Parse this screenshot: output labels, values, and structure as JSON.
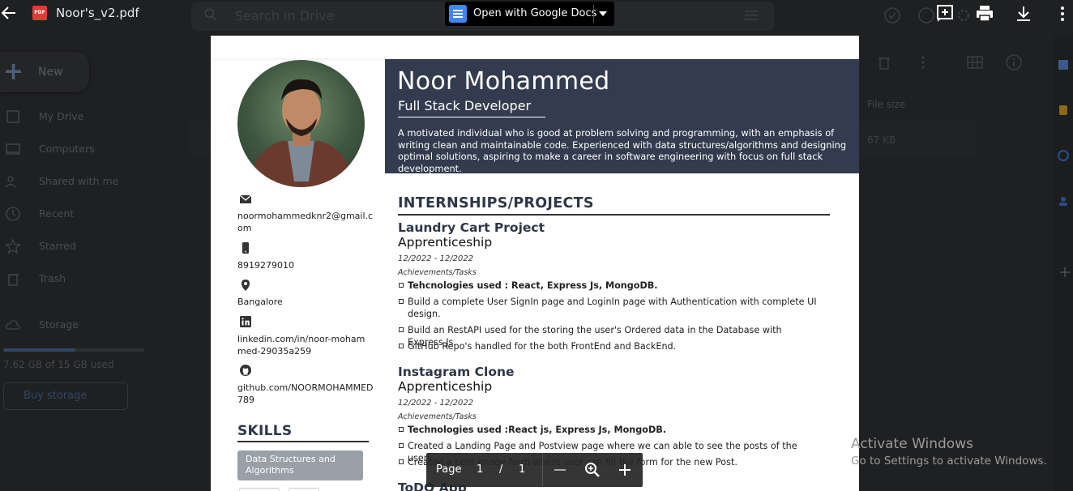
{
  "viewer": {
    "file_name": "Noor's_v2.pdf",
    "pdf_badge": "PDF",
    "open_with_label": "Open with Google Docs"
  },
  "drive": {
    "search_placeholder": "Search in Drive",
    "new_label": "New",
    "nav": [
      "My Drive",
      "Computers",
      "Shared with me",
      "Recent",
      "Starred",
      "Trash",
      "Storage"
    ],
    "storage_used": "7.62 GB of 15 GB used",
    "storage_fraction": 0.51,
    "buy_storage": "Buy storage",
    "col_file_size": "File size",
    "file_size_value": "67 KB"
  },
  "resume": {
    "name": "Noor Mohammed",
    "role": "Full Stack Developer",
    "summary": "A motivated individual who is good at problem solving and programming, with an emphasis of writing clean and maintainable code. Experienced with data structures/algorithms and designing optimal solutions, aspiring to make a career in software engineering with focus on full stack development.",
    "contact": {
      "email": "noormohammedknr2@gmail.com",
      "phone": "8919279010",
      "location": "Bangalore",
      "linkedin": "linkedin.com/in/noor-mohammed-29035a259",
      "github": "github.com/NOORMOHAMMED789"
    },
    "skills_title": "SKILLS",
    "skills": [
      "Data Structures and Algorithms"
    ],
    "section_title": "INTERNSHIPS/PROJECTS",
    "projects": [
      {
        "title": "Laundry Cart Project",
        "role": "Apprenticeship",
        "date": "12/2022 - 12/2022",
        "achievements_label": "Achievements/Tasks",
        "bullets": [
          "Tehcnologies used : React, Express Js, MongoDB.",
          "Build a complete User SignIn page and LoginIn page with Authentication with complete UI design.",
          "Build an RestAPI used for the storing the user's Ordered data in the Database with Express Js.",
          "GitHub Repo's handled for the both FrontEnd and BackEnd."
        ]
      },
      {
        "title": "Instagram Clone",
        "role": "Apprenticeship",
        "date": "12/2022 - 12/2022",
        "achievements_label": "Achievements/Tasks",
        "bullets": [
          "Technologies used :React js, Express Js, MongoDB.",
          "Created a Landing Page and Postview page where we can able to see the posts of the users",
          "Created a post-image form where user can fill the form for the new Post."
        ]
      },
      {
        "title": "ToDO App"
      }
    ]
  },
  "page_toolbar": {
    "label": "Page",
    "current": "1",
    "separator": "/",
    "total": "1"
  },
  "watermark": {
    "title": "Activate Windows",
    "subtitle": "Go to Settings to activate Windows."
  }
}
